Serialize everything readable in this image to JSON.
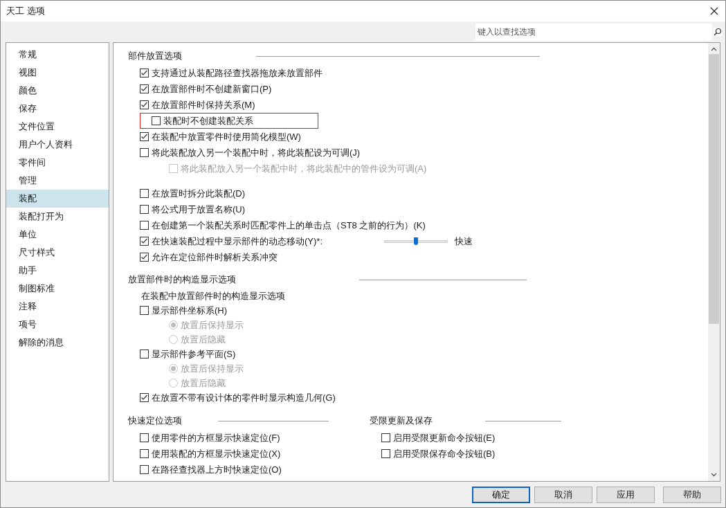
{
  "window": {
    "title": "天工 选项"
  },
  "search": {
    "placeholder": "键入以查找选项"
  },
  "sidebar": {
    "items": [
      {
        "label": "常规",
        "selected": false
      },
      {
        "label": "视图",
        "selected": false
      },
      {
        "label": "颜色",
        "selected": false
      },
      {
        "label": "保存",
        "selected": false
      },
      {
        "label": "文件位置",
        "selected": false
      },
      {
        "label": "用户个人资料",
        "selected": false
      },
      {
        "label": "零件间",
        "selected": false
      },
      {
        "label": "管理",
        "selected": false
      },
      {
        "label": "装配",
        "selected": true
      },
      {
        "label": "装配打开为",
        "selected": false
      },
      {
        "label": "单位",
        "selected": false
      },
      {
        "label": "尺寸样式",
        "selected": false
      },
      {
        "label": "助手",
        "selected": false
      },
      {
        "label": "制图标准",
        "selected": false
      },
      {
        "label": "注释",
        "selected": false
      },
      {
        "label": "项号",
        "selected": false
      },
      {
        "label": "解除的消息",
        "selected": false
      }
    ]
  },
  "sections": [
    {
      "title": "部件放置选项",
      "groups": [
        [
          {
            "kind": "checkbox",
            "label": "支持通过从装配路径查找器拖放来放置部件",
            "checked": true
          },
          {
            "kind": "checkbox",
            "label": "在放置部件时不创建新窗口(P)",
            "checked": true
          },
          {
            "kind": "checkbox",
            "label": "在放置部件时保持关系(M)",
            "checked": true
          },
          {
            "kind": "checkbox",
            "label": "装配时不创建装配关系",
            "checked": false,
            "highlighted": true
          },
          {
            "kind": "checkbox",
            "label": "在装配中放置零件时使用简化模型(W)",
            "checked": true
          },
          {
            "kind": "checkbox",
            "label": "将此装配放入另一个装配中时，将此装配设为可调(J)",
            "checked": false,
            "children": [
              {
                "kind": "checkbox",
                "label": "将此装配放入另一个装配中时，将此装配中的管件设为可调(A)",
                "checked": false,
                "disabled": true
              }
            ]
          }
        ],
        [
          {
            "kind": "checkbox",
            "label": "在放置时拆分此装配(D)",
            "checked": false
          },
          {
            "kind": "checkbox",
            "label": "将公式用于放置名称(U)",
            "checked": false
          },
          {
            "kind": "checkbox",
            "label": "在创建第一个装配关系时匹配零件上的单击点（ST8 之前的行为）(K)",
            "checked": false
          },
          {
            "kind": "checkbox",
            "label": "在快速装配过程中显示部件的动态移动(Y)*:",
            "checked": true,
            "slider": {
              "level": 0.5,
              "label": "快速"
            }
          },
          {
            "kind": "checkbox",
            "label": "允许在定位部件时解析关系冲突",
            "checked": true
          }
        ]
      ]
    },
    {
      "title": "放置部件时的构造显示选项",
      "groups": [
        [
          {
            "kind": "label",
            "label": "在装配中放置部件时的构造显示选项"
          },
          {
            "kind": "checkbox",
            "label": "显示部件坐标系(H)",
            "checked": false,
            "children": [
              {
                "kind": "radio",
                "label": "放置后保持显示",
                "selected": true,
                "disabled": true
              },
              {
                "kind": "radio",
                "label": "放置后隐藏",
                "selected": false,
                "disabled": true
              }
            ]
          },
          {
            "kind": "checkbox",
            "label": "显示部件参考平面(S)",
            "checked": false,
            "children": [
              {
                "kind": "radio",
                "label": "放置后保持显示",
                "selected": true,
                "disabled": true
              },
              {
                "kind": "radio",
                "label": "放置后隐藏",
                "selected": false,
                "disabled": true
              }
            ]
          },
          {
            "kind": "checkbox",
            "label": "在放置不带有设计体的零件时显示构造几何(G)",
            "checked": true
          }
        ]
      ]
    }
  ],
  "columns": [
    {
      "title": "快速定位选项",
      "items": [
        {
          "kind": "checkbox",
          "label": "使用零件的方框显示快速定位(F)",
          "checked": false
        },
        {
          "kind": "checkbox",
          "label": "使用装配的方框显示快速定位(X)",
          "checked": false
        },
        {
          "kind": "checkbox",
          "label": "在路径查找器上方时快速定位(O)",
          "checked": false
        }
      ]
    },
    {
      "title": "受限更新及保存",
      "items": [
        {
          "kind": "checkbox",
          "label": "启用受限更新命令按钮(E)",
          "checked": false
        },
        {
          "kind": "checkbox",
          "label": "启用受限保存命令按钮(B)",
          "checked": false
        }
      ]
    }
  ],
  "buttons": [
    {
      "label": "确定",
      "default": true
    },
    {
      "label": "取消",
      "default": false
    },
    {
      "label": "应用",
      "default": false
    },
    {
      "label": "帮助",
      "default": false
    }
  ]
}
